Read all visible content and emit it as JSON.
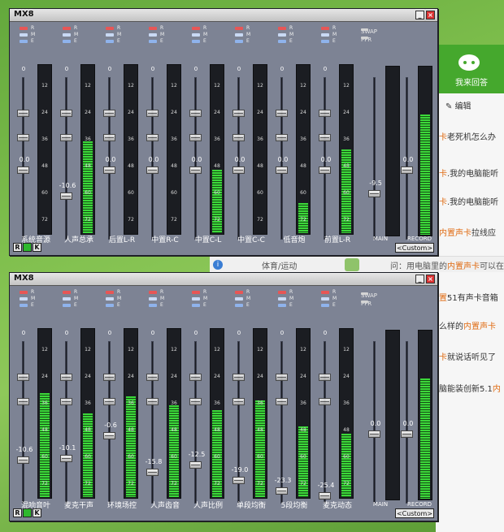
{
  "background": {
    "side_button": "我来回答",
    "edit_label": "编辑",
    "questions": [
      {
        "pre": "",
        "hl": "卡",
        "post": "老死机怎么办"
      },
      {
        "pre": "",
        "hl": "卡",
        "post": ".我的电脑能听"
      },
      {
        "pre": "",
        "hl": "卡",
        "post": ".我的电脑能听"
      },
      {
        "pre": "",
        "hl": "内置声卡",
        "post": "拉线应"
      },
      {
        "pre": "",
        "hl": "置",
        "post": "51有声卡音箱"
      },
      {
        "pre": "么样的",
        "hl": "内置声卡",
        "post": ""
      },
      {
        "pre": "",
        "hl": "卡",
        "post": "就说话听见了"
      },
      {
        "pre": "脑能装创新5.1",
        "hl": "内",
        "post": ""
      }
    ],
    "strip_tag": "体育/运动",
    "strip_q_pre": "问：用电脑里的",
    "strip_q_hl": "内置声卡",
    "strip_q_post": "可以在"
  },
  "windows": [
    {
      "title": "MX8",
      "swap_label": "SWAP",
      "pfr_label": "PFR",
      "custom_label": "<Custom>",
      "bottom_buttons": [
        "R",
        "●",
        "K"
      ],
      "channels": [
        {
          "name": "系统音源",
          "value": "0.0",
          "level": 0.0
        },
        {
          "name": "人声总承",
          "value": "-10.6",
          "level": 0.55
        },
        {
          "name": "后置L-R",
          "value": "0.0",
          "level": 0.0
        },
        {
          "name": "中置R-C",
          "value": "0.0",
          "level": 0.0
        },
        {
          "name": "中置C-L",
          "value": "0.0",
          "level": 0.38
        },
        {
          "name": "中置C-C",
          "value": "0.0",
          "level": 0.0
        },
        {
          "name": "低音炮",
          "value": "0.0",
          "level": 0.18
        },
        {
          "name": "前置L-R",
          "value": "0.0",
          "level": 0.5
        }
      ],
      "main": {
        "label": "MAIN",
        "value": "-9.5",
        "level": 0.0
      },
      "record": {
        "label": "RECORD",
        "value": "0.0",
        "level": 0.72
      }
    },
    {
      "title": "MX8",
      "swap_label": "SWAP",
      "pfr_label": "PFR",
      "custom_label": "<Custom>",
      "bottom_buttons": [
        "R",
        "●",
        "K"
      ],
      "channels": [
        {
          "name": "混响音叶",
          "value": "-10.6",
          "level": 0.62
        },
        {
          "name": "麦克干声",
          "value": "-10.1",
          "level": 0.5
        },
        {
          "name": "环境场控",
          "value": "-0.6",
          "level": 0.6
        },
        {
          "name": "人声齿音",
          "value": "-15.8",
          "level": 0.55
        },
        {
          "name": "人声比例",
          "value": "-12.5",
          "level": 0.52
        },
        {
          "name": "单段均衡",
          "value": "-19.0",
          "level": 0.58
        },
        {
          "name": "5段均衡",
          "value": "-23.3",
          "level": 0.42
        },
        {
          "name": "麦克动态",
          "value": "-25.4",
          "level": 0.38
        }
      ],
      "main": {
        "label": "MAIN",
        "value": "0.0",
        "level": 0.0
      },
      "record": {
        "label": "RECORD",
        "value": "0.0",
        "level": 0.72
      }
    }
  ],
  "meter_marks": [
    "12",
    "24",
    "36",
    "48",
    "60",
    "72"
  ],
  "fader_ticks": [
    "0",
    "-12",
    "-24"
  ],
  "led_labels": [
    "R",
    "M",
    "E"
  ],
  "colors": {
    "panel": "#7d8394",
    "meter_on": "#3cd83a",
    "led_r": "#e75656",
    "close": "#dd3333"
  }
}
